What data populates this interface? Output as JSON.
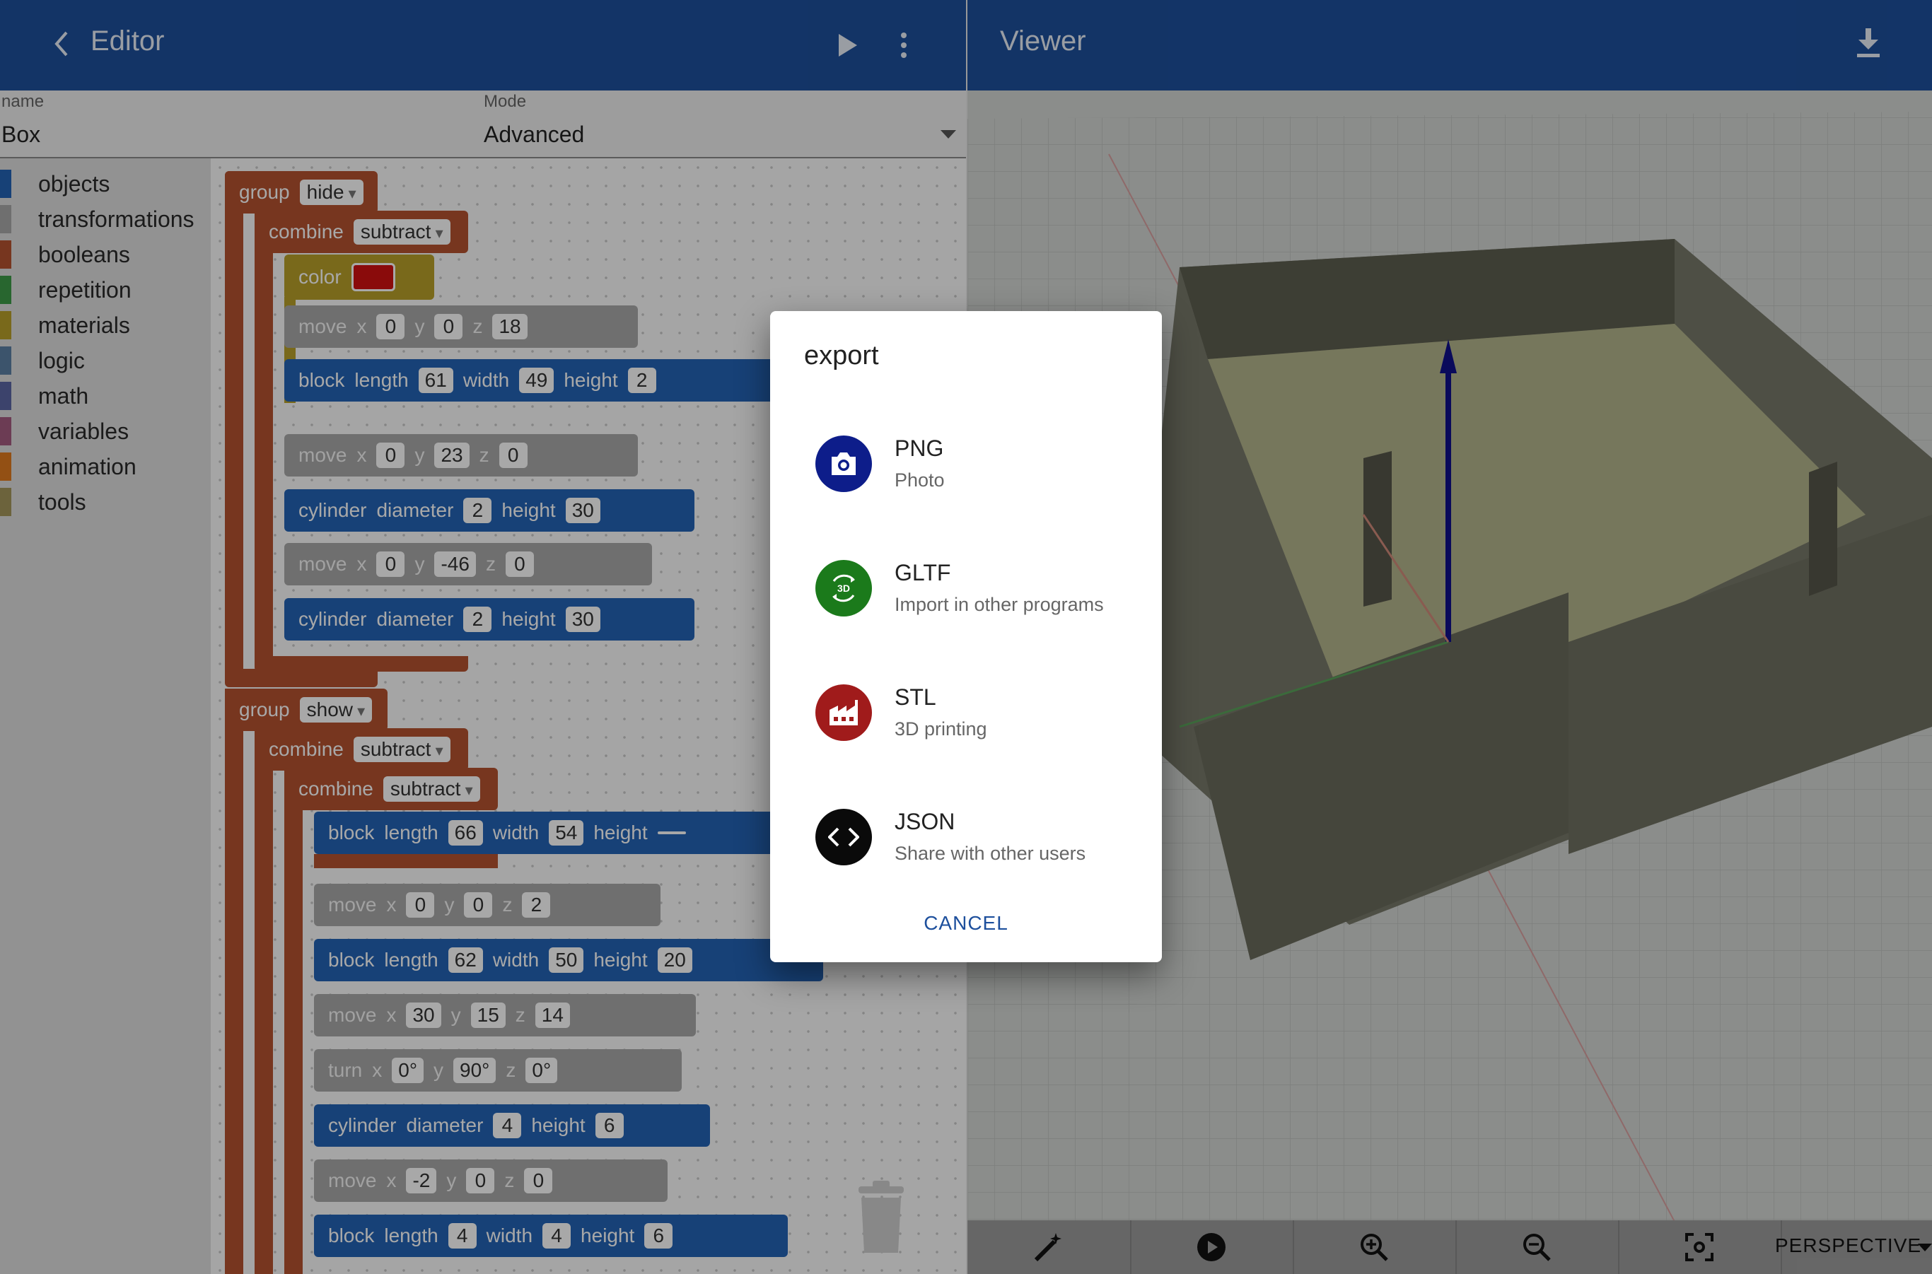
{
  "editor": {
    "title": "Editor",
    "name_label": "name",
    "name_value": "Box",
    "mode_label": "Mode",
    "mode_value": "Advanced"
  },
  "viewer": {
    "title": "Viewer",
    "camera_mode": "PERSPECTIVE"
  },
  "toolbox": [
    {
      "label": "objects",
      "color": "#2463b5"
    },
    {
      "label": "transformations",
      "color": "#a9a9a9"
    },
    {
      "label": "booleans",
      "color": "#b5522f"
    },
    {
      "label": "repetition",
      "color": "#3e9b48"
    },
    {
      "label": "materials",
      "color": "#b8a02a"
    },
    {
      "label": "logic",
      "color": "#5b80a5"
    },
    {
      "label": "math",
      "color": "#5b67a5"
    },
    {
      "label": "variables",
      "color": "#a55b80"
    },
    {
      "label": "animation",
      "color": "#e07a1f"
    },
    {
      "label": "tools",
      "color": "#a5965b"
    }
  ],
  "blocks": {
    "group1": {
      "kw": "group",
      "mode": "hide"
    },
    "combine1": {
      "kw": "combine",
      "op": "subtract"
    },
    "color": {
      "kw": "color"
    },
    "move1": {
      "kw": "move",
      "x": "0",
      "y": "0",
      "z": "18"
    },
    "block1": {
      "kw": "block",
      "length": "61",
      "width": "49",
      "height": "2"
    },
    "move2": {
      "kw": "move",
      "x": "0",
      "y": "23",
      "z": "0"
    },
    "cyl1": {
      "kw": "cylinder",
      "diameter": "2",
      "height": "30"
    },
    "move3": {
      "kw": "move",
      "x": "0",
      "y": "-46",
      "z": "0"
    },
    "cyl2": {
      "kw": "cylinder",
      "diameter": "2",
      "height": "30"
    },
    "group2": {
      "kw": "group",
      "mode": "show"
    },
    "combine2": {
      "kw": "combine",
      "op": "subtract"
    },
    "combine3": {
      "kw": "combine",
      "op": "subtract"
    },
    "block2": {
      "kw": "block",
      "length": "66",
      "width": "54",
      "height": ""
    },
    "move4": {
      "kw": "move",
      "x": "0",
      "y": "0",
      "z": "2"
    },
    "block3": {
      "kw": "block",
      "length": "62",
      "width": "50",
      "height": "20"
    },
    "move5": {
      "kw": "move",
      "x": "30",
      "y": "15",
      "z": "14"
    },
    "turn1": {
      "kw": "turn",
      "x": "0°",
      "y": "90°",
      "z": "0°"
    },
    "cyl3": {
      "kw": "cylinder",
      "diameter": "4",
      "height": "6"
    },
    "move6": {
      "kw": "move",
      "x": "-2",
      "y": "0",
      "z": "0"
    },
    "block4": {
      "kw": "block",
      "length": "4",
      "width": "4",
      "height": "6"
    }
  },
  "labels": {
    "x": "x",
    "y": "y",
    "z": "z",
    "length": "length",
    "width": "width",
    "height": "height",
    "diameter": "diameter"
  },
  "dialog": {
    "title": "export",
    "options": [
      {
        "name": "PNG",
        "desc": "Photo",
        "icon": "camera-icon",
        "color": "#0d1d8a"
      },
      {
        "name": "GLTF",
        "desc": "Import in other programs",
        "icon": "3d-rotation-icon",
        "color": "#1b7a1b"
      },
      {
        "name": "STL",
        "desc": "3D printing",
        "icon": "factory-icon",
        "color": "#a01b1b"
      },
      {
        "name": "JSON",
        "desc": "Share with other users",
        "icon": "code-icon",
        "color": "#0a0a0a"
      }
    ],
    "cancel": "CANCEL"
  }
}
